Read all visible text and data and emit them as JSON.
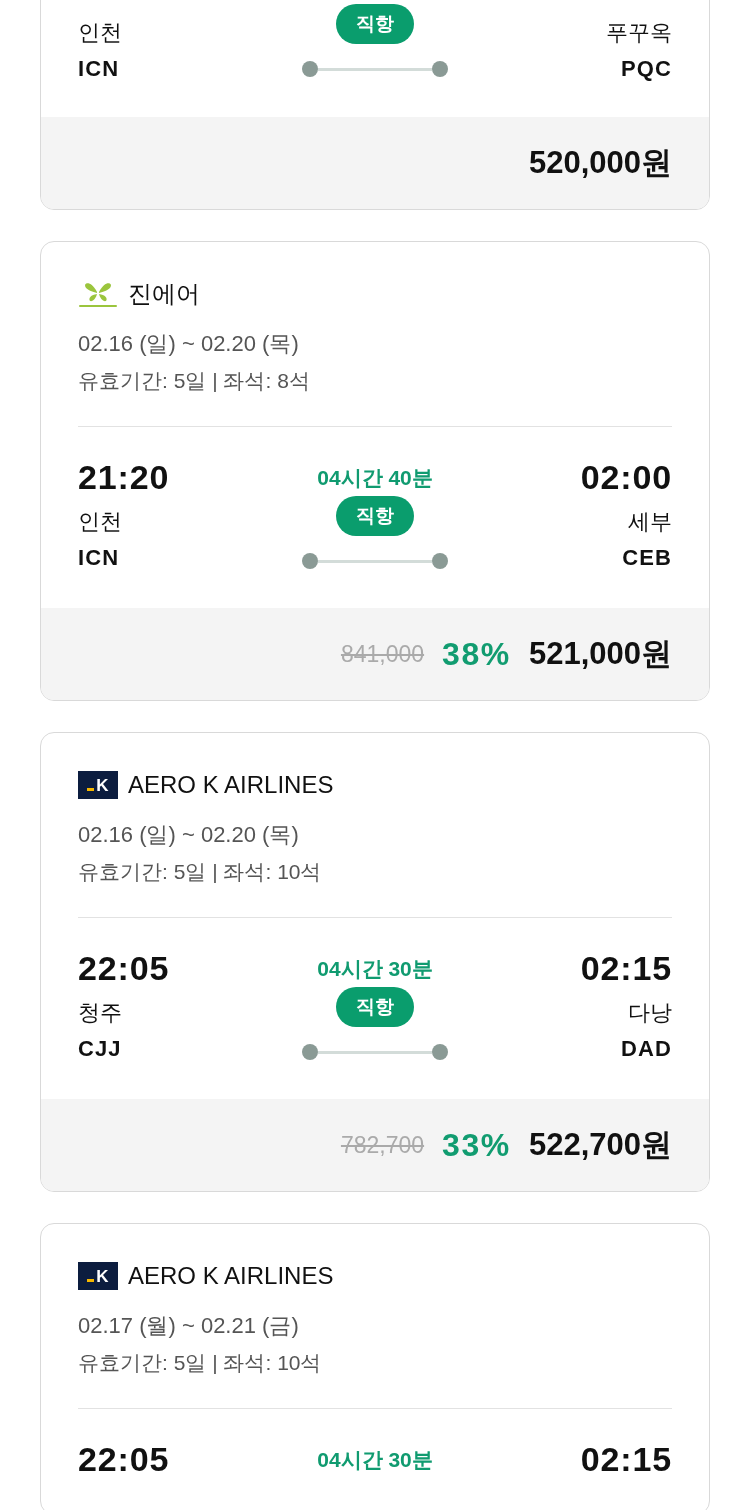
{
  "flights": [
    {
      "route": {
        "from": {
          "city": "인천",
          "code": "ICN"
        },
        "to": {
          "city": "푸꾸옥",
          "code": "PQC"
        },
        "badge": "직항"
      },
      "price": {
        "final": "520,000원"
      }
    },
    {
      "airline": {
        "name": "진에어",
        "kind": "butterfly"
      },
      "dates": "02.16 (일) ~ 02.20 (목)",
      "validity": "유효기간: 5일 | 좌석: 8석",
      "route": {
        "from": {
          "time": "21:20",
          "city": "인천",
          "code": "ICN"
        },
        "duration": "04시간 40분",
        "to": {
          "time": "02:00",
          "city": "세부",
          "code": "CEB"
        },
        "badge": "직항"
      },
      "price": {
        "original": "841,000",
        "discount": "38%",
        "final": "521,000원"
      }
    },
    {
      "airline": {
        "name": "AERO K AIRLINES",
        "kind": "square",
        "logo_mark": "K"
      },
      "dates": "02.16 (일) ~ 02.20 (목)",
      "validity": "유효기간: 5일 | 좌석: 10석",
      "route": {
        "from": {
          "time": "22:05",
          "city": "청주",
          "code": "CJJ"
        },
        "duration": "04시간 30분",
        "to": {
          "time": "02:15",
          "city": "다낭",
          "code": "DAD"
        },
        "badge": "직항"
      },
      "price": {
        "original": "782,700",
        "discount": "33%",
        "final": "522,700원"
      }
    },
    {
      "airline": {
        "name": "AERO K AIRLINES",
        "kind": "square",
        "logo_mark": "K"
      },
      "dates": "02.17 (월) ~ 02.21 (금)",
      "validity": "유효기간: 5일 | 좌석: 10석",
      "route": {
        "from": {
          "time": "22:05"
        },
        "duration": "04시간 30분",
        "to": {
          "time": "02:15"
        }
      }
    }
  ]
}
